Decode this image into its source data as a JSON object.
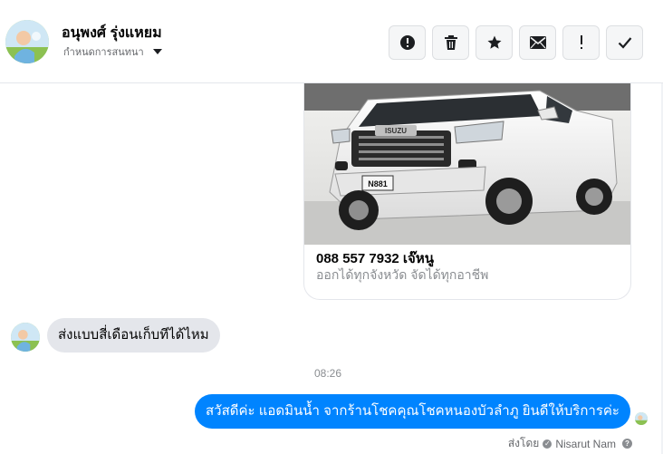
{
  "contact": {
    "name": "อนุพงศ์ รุ่งแหยม",
    "settings_label": "กำหนดการสนทนา"
  },
  "toolbar": [
    {
      "icon": "exclamation-circle-icon",
      "tooltip": ""
    },
    {
      "icon": "trash-icon",
      "tooltip": ""
    },
    {
      "icon": "star-icon",
      "tooltip": ""
    },
    {
      "icon": "envelope-icon",
      "tooltip": ""
    },
    {
      "icon": "exclamation-icon",
      "tooltip": ""
    },
    {
      "icon": "checkmark-icon",
      "tooltip": ""
    }
  ],
  "shared_card": {
    "title": "088 557 7932 เจ๊หนู",
    "subtitle": "ออกได้ทุกจังหวัด จัดได้ทุกอาชีพ",
    "image_badge": "ISUZU",
    "image_plate": "N881"
  },
  "messages": {
    "incoming_text": "ส่งแบบสี่เดือนเก็บทีได้ไหม",
    "timestamp": "08:26",
    "outgoing_text": "สวัสดีค่ะ แอดมินน้ำ จากร้านโชคคุณโชคหนองบัวลำภู ยินดีให้บริการค่ะ",
    "sent_by_label": "ส่งโดย",
    "sent_by_name": "Nisarut Nam"
  },
  "colors": {
    "outgoing_bubble": "#0084ff",
    "incoming_bubble": "#e4e6eb",
    "toolbar_bg": "#f5f6f7"
  }
}
